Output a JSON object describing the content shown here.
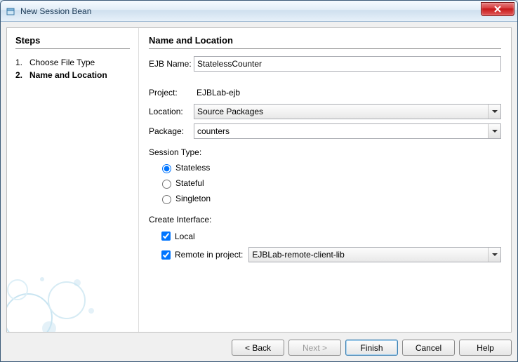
{
  "window": {
    "title": "New Session Bean"
  },
  "steps": {
    "heading": "Steps",
    "items": [
      {
        "num": "1.",
        "label": "Choose File Type",
        "current": false
      },
      {
        "num": "2.",
        "label": "Name and Location",
        "current": true
      }
    ]
  },
  "form": {
    "heading": "Name and Location",
    "ejb_name_label": "EJB Name:",
    "ejb_name_value": "StatelessCounter",
    "project_label": "Project:",
    "project_value": "EJBLab-ejb",
    "location_label": "Location:",
    "location_value": "Source Packages",
    "package_label": "Package:",
    "package_value": "counters",
    "session_type_label": "Session Type:",
    "session_options": {
      "stateless": "Stateless",
      "stateful": "Stateful",
      "singleton": "Singleton"
    },
    "create_interface_label": "Create Interface:",
    "local_label": "Local",
    "remote_label": "Remote in project:",
    "remote_project_value": "EJBLab-remote-client-lib"
  },
  "buttons": {
    "back": "< Back",
    "next": "Next >",
    "finish": "Finish",
    "cancel": "Cancel",
    "help": "Help"
  }
}
